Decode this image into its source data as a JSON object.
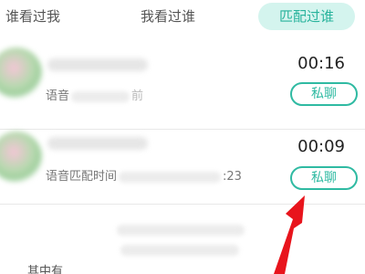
{
  "tabs": {
    "who_viewed_me": "谁看过我",
    "i_viewed": "我看过谁",
    "matched": "匹配过谁"
  },
  "matches": [
    {
      "duration": "00:16",
      "subtitle_prefix": "语音",
      "subtitle_suffix": "前",
      "chat_label": "私聊"
    },
    {
      "duration": "00:09",
      "subtitle_prefix": "语音匹配时间",
      "subtitle_suffix": ":23",
      "chat_label": "私聊"
    }
  ],
  "notice": {
    "prefix": "其中有"
  },
  "colors": {
    "accent": "#2fbaa2",
    "active_tab_bg": "#d4f4ee",
    "arrow": "#e8141c"
  }
}
